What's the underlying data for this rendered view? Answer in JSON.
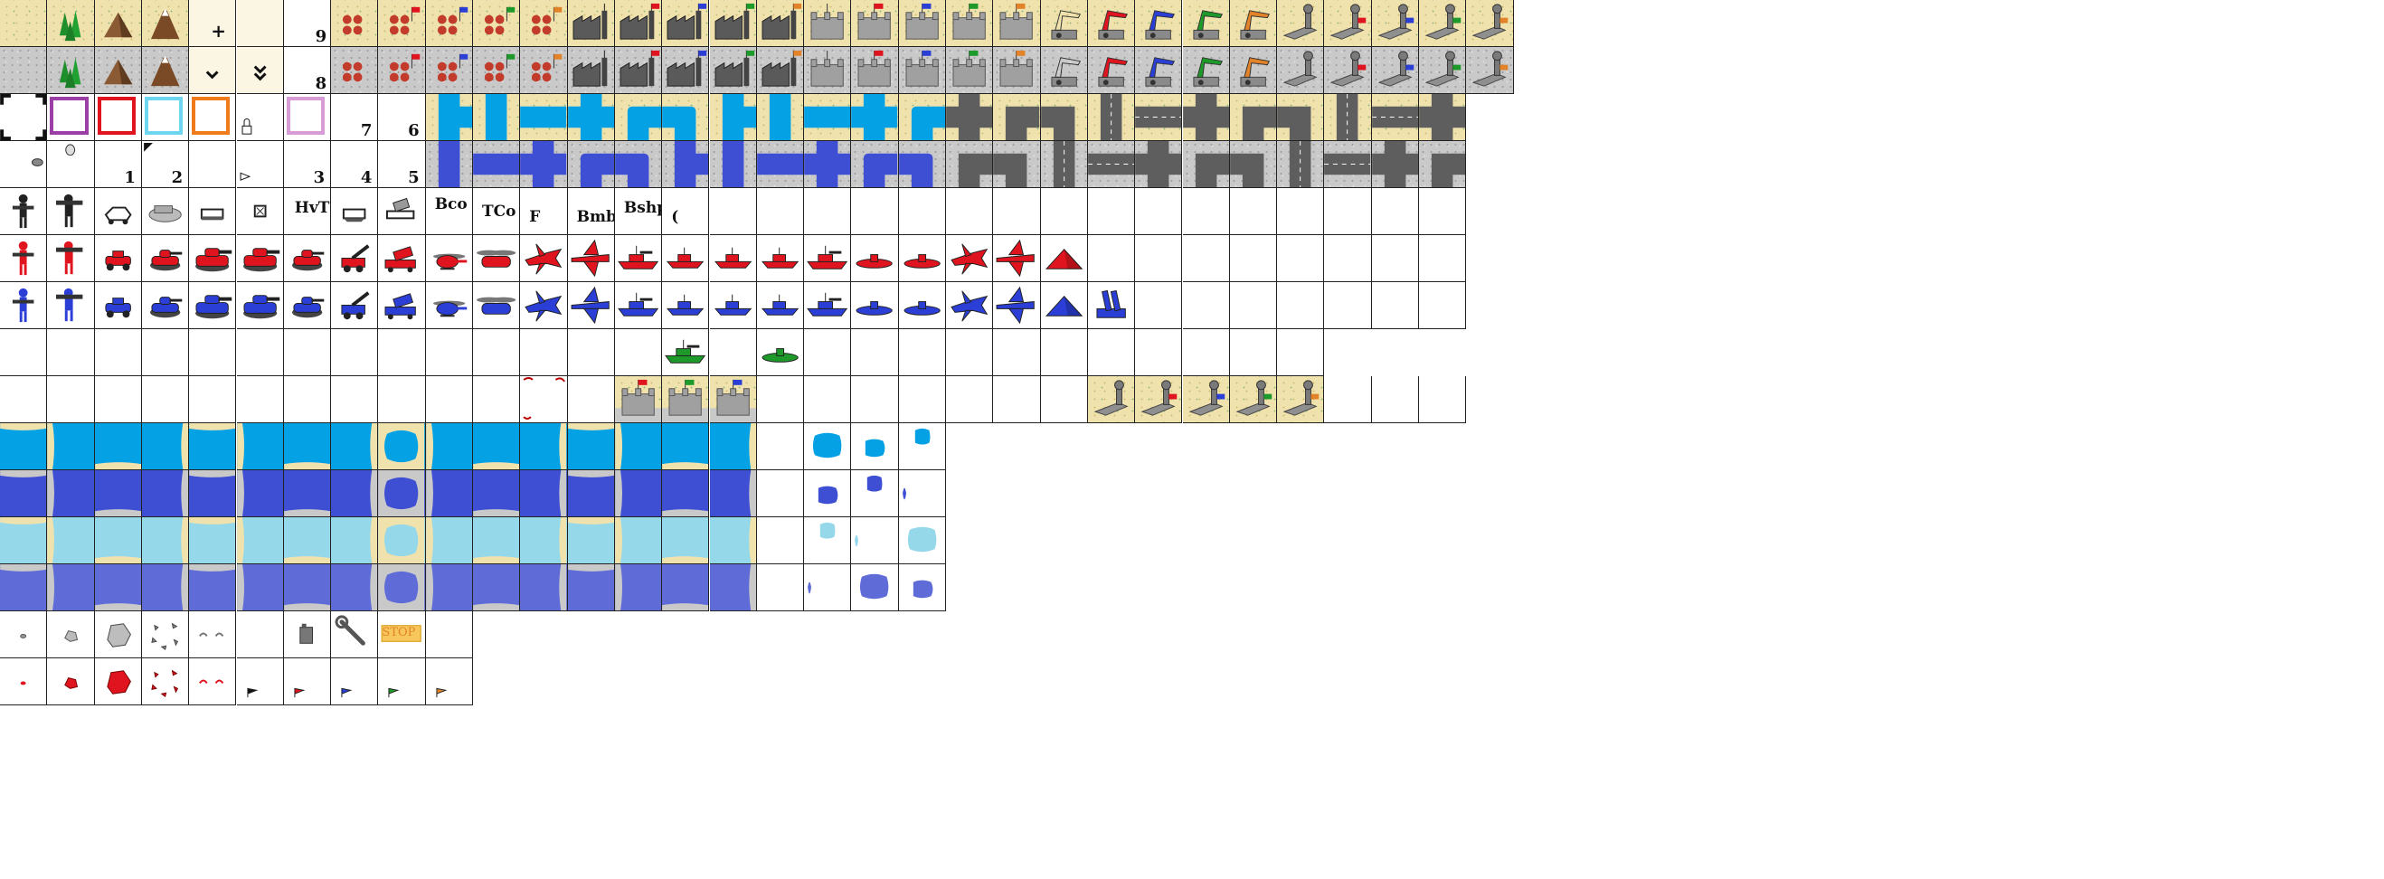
{
  "colors": {
    "red": "#e0141e",
    "blue": "#2b3fd6",
    "green": "#1e9a2a",
    "black": "#111111",
    "orange": "#e2832a",
    "sand": "#efe2ad",
    "stone": "#c9c9c9",
    "sea_light": "#04a1e4",
    "sea_dark": "#3e4fd3",
    "shallow": "#95d8ea",
    "sea_mid": "#5f6cd8",
    "frame_purple": "#9b3ea6",
    "frame_red": "#e0141e",
    "frame_cyan": "#6fd6ef",
    "frame_orange": "#f07b1c",
    "frame_pink": "#d79bd8"
  },
  "number_labels": [
    "9",
    "8",
    "7",
    "6",
    "1",
    "2",
    "3",
    "4",
    "5"
  ],
  "unit_labels": [
    "HvT",
    "Bco",
    "TCo",
    "F",
    "Bmb",
    "Bshp",
    "("
  ],
  "overlay_labels": {
    "plus": "+",
    "stop": "STOP"
  },
  "icons": {
    "row0": [
      "forest-icon",
      "mountain-icon",
      "volcano-icon",
      "plus-cursor-icon"
    ],
    "row1": [
      "forest-icon",
      "mountain-icon",
      "volcano-icon",
      "chevron-down-icon",
      "double-chevron-down-icon"
    ],
    "buildings": [
      "city-icon",
      "factory-icon",
      "hq-tower-icon",
      "crane-port-icon",
      "airport-icon"
    ],
    "units": [
      "infantry-icon",
      "mech-icon",
      "recon-icon",
      "apc-icon",
      "tank-icon",
      "medium-tank-icon",
      "heavy-tank-icon",
      "artillery-icon",
      "rocket-icon",
      "battle-copter-icon",
      "transport-copter-icon",
      "fighter-icon",
      "bomber-icon",
      "battleship-icon",
      "cruiser-icon",
      "submarine-icon",
      "lander-icon",
      "stealth-icon",
      "pyramid-icon",
      "missile-launcher-icon"
    ],
    "effects": [
      "small-smoke-icon",
      "rock-icon",
      "boulder-icon",
      "debris-icon",
      "spark-icon",
      "fuel-can-icon",
      "wrench-icon",
      "stop-sign-icon"
    ],
    "flags": [
      "flag-black-icon",
      "flag-red-icon",
      "flag-blue-icon",
      "flag-green-icon",
      "flag-orange-icon"
    ]
  },
  "team_flags": [
    "red",
    "blue",
    "green",
    "orange"
  ]
}
